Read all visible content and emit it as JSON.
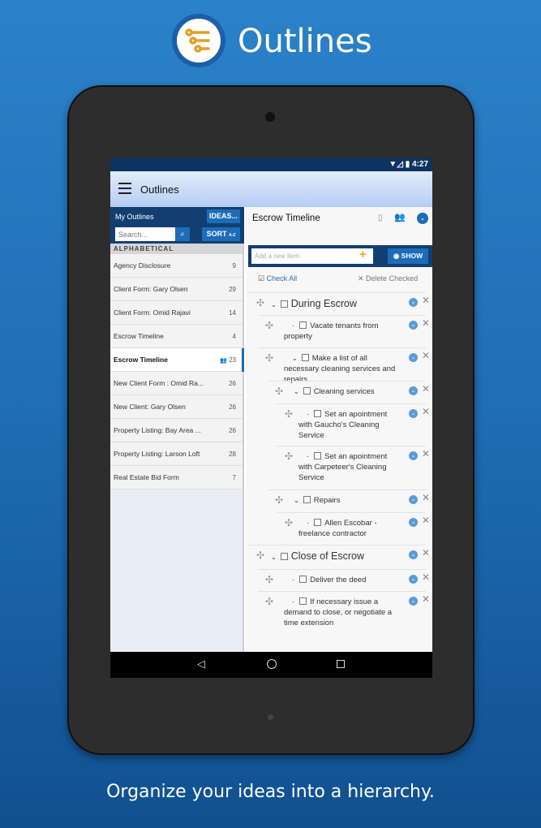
{
  "header": {
    "title": "Outlines",
    "logo_icon": "outline-tree-icon"
  },
  "caption": "Organize your ideas into a hierarchy.",
  "status_bar": {
    "time": "4:27"
  },
  "app_bar": {
    "title": "Outlines"
  },
  "sidebar": {
    "title": "My Outlines",
    "ideas_label": "IDEAS...",
    "search_placeholder": "Search...",
    "sort_label": "SORT",
    "sort_sub": "A-Z",
    "section": "ALPHABETICAL",
    "items": [
      {
        "label": "Agency Disclosure",
        "count": "9"
      },
      {
        "label": "Client Form: Gary Olsen",
        "count": "29"
      },
      {
        "label": "Client Form: Omid Rajavi",
        "count": "14"
      },
      {
        "label": "Escrow Timeline",
        "count": "4"
      },
      {
        "label": "Escrow Timeline",
        "count": "23",
        "selected": true,
        "shared": true
      },
      {
        "label": "New Client Form : Omid Ra...",
        "count": "26"
      },
      {
        "label": "New Client: Gary Olsen",
        "count": "26"
      },
      {
        "label": "Property Listing: Bay Area ...",
        "count": "26"
      },
      {
        "label": "Property Listing: Larson Loft",
        "count": "28"
      },
      {
        "label": "Real Estate Bid Form",
        "count": "7"
      }
    ]
  },
  "main": {
    "title": "Escrow Timeline",
    "add_placeholder": "Add a new item",
    "show_label": "SHOW",
    "check_all": "Check All",
    "delete_checked": "Delete Checked",
    "items": [
      {
        "text": "During Escrow",
        "level": 0,
        "expandable": true
      },
      {
        "text": "Vacate tenants from property",
        "level": 1
      },
      {
        "text": "Make a list of all necessary cleaning services and repairs",
        "level": 1,
        "expandable": true
      },
      {
        "text": "Cleaning services",
        "level": 2,
        "expandable": true
      },
      {
        "text": "Set an apointment with Gaucho's Cleaning Service",
        "level": 3
      },
      {
        "text": "Set an apointment with Carpeteer's Cleaning Service",
        "level": 3
      },
      {
        "text": "Repairs",
        "level": 2,
        "expandable": true
      },
      {
        "text": "Allen Escobar - freelance contractor",
        "level": 3
      },
      {
        "text": "Close of Escrow",
        "level": 0,
        "expandable": true
      },
      {
        "text": "Deliver the deed",
        "level": 1
      },
      {
        "text": "If necessary issue a demand to close, or negotiate a time extension",
        "level": 1
      }
    ]
  },
  "colors": {
    "accent": "#1c6cb8",
    "navy": "#123f72",
    "fab": "#f2a71c"
  }
}
